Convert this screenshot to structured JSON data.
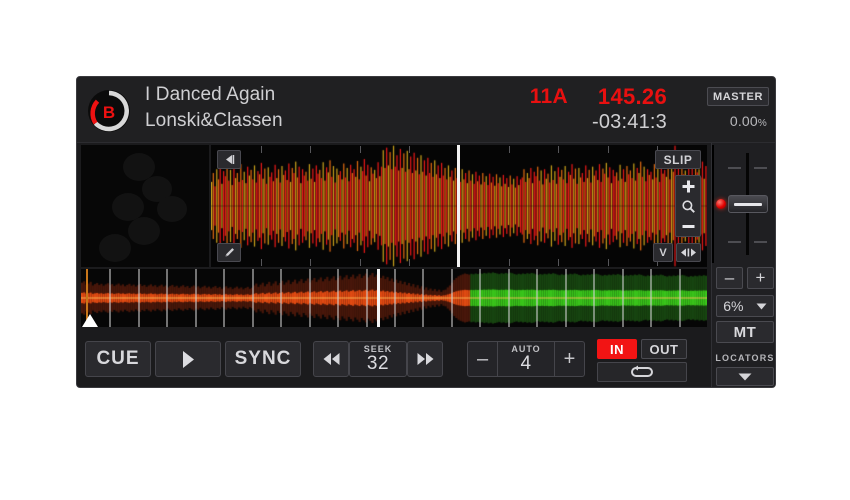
{
  "deck": {
    "badge_letter": "B",
    "badge_progress_color": "#ee1111",
    "badge_ring_color": "#d8d8d8"
  },
  "track": {
    "title": "I Danced Again",
    "artist": "Lonski&Classen",
    "key": "11A",
    "bpm": "145.26",
    "time_remaining": "-03:41:3"
  },
  "header": {
    "master_label": "MASTER",
    "pitch_percent": "0.00",
    "pitch_percent_symbol": "%"
  },
  "waveform": {
    "back_icon": "triangle-left-icon",
    "pencil_icon": "pencil-icon",
    "slip_label": "SLIP",
    "zoom_in_icon": "plus-icon",
    "zoom_icon": "magnifier-icon",
    "zoom_out_icon": "minus-icon",
    "view_label": "V",
    "pan_icon": "left-right-arrows-icon",
    "playhead_position_pct": 49.6
  },
  "overview": {
    "playhead_position_pct": 47.3,
    "start_marker_icon": "triangle-up-marker"
  },
  "transport": {
    "cue_label": "CUE",
    "play_icon": "play-triangle-icon",
    "sync_label": "SYNC",
    "rewind_icon": "rewind-icon",
    "forward_icon": "fast-forward-icon",
    "seek_caption": "SEEK",
    "seek_value": "32",
    "auto_caption": "AUTO",
    "auto_value": "4",
    "minus_label": "–",
    "plus_label": "+",
    "loop_in_label": "IN",
    "loop_out_label": "OUT",
    "loop_repeat_icon": "loop-repeat-icon",
    "loop_in_active_color": "#f21414"
  },
  "pitch_panel": {
    "minus_label": "–",
    "plus_label": "+",
    "range_value": "6%",
    "range_chevron_icon": "chevron-down-icon",
    "master_tempo_label": "MT",
    "locators_label": "LOCATORS",
    "locators_chevron_icon": "chevron-down-icon",
    "led_color": "#e00000"
  },
  "chart_data": {
    "type": "area",
    "title": "Main waveform amplitude (red/orange energy)",
    "main_wave": [
      0.38,
      0.52,
      0.31,
      0.58,
      0.42,
      0.61,
      0.35,
      0.55,
      0.47,
      0.63,
      0.4,
      0.57,
      0.33,
      0.6,
      0.44,
      0.52,
      0.38,
      0.66,
      0.41,
      0.54,
      0.36,
      0.62,
      0.48,
      0.57,
      0.42,
      0.64,
      0.37,
      0.55,
      0.5,
      0.68,
      0.43,
      0.59,
      0.35,
      0.61,
      0.46,
      0.53,
      0.39,
      0.65,
      0.44,
      0.58,
      0.37,
      0.63,
      0.49,
      0.56,
      0.41,
      0.67,
      0.38,
      0.6,
      0.52,
      0.7,
      0.45,
      0.62,
      0.36,
      0.58,
      0.48,
      0.54,
      0.4,
      0.66,
      0.43,
      0.59,
      0.38,
      0.64,
      0.51,
      0.57,
      0.44,
      0.69,
      0.4,
      0.61,
      0.53,
      0.72,
      0.46,
      0.63,
      0.37,
      0.59,
      0.49,
      0.55,
      0.42,
      0.67,
      0.45,
      0.6,
      0.39,
      0.65,
      0.52,
      0.58,
      0.46,
      0.71,
      0.42,
      0.62,
      0.55,
      0.74,
      0.48,
      0.65,
      0.39,
      0.61,
      0.51,
      0.57,
      0.44,
      0.69,
      0.47,
      0.62,
      0.88,
      0.6,
      0.92,
      0.64,
      0.85,
      0.58,
      0.95,
      0.62,
      0.8,
      0.56,
      0.9,
      0.6,
      0.83,
      0.54,
      0.87,
      0.58,
      0.78,
      0.52,
      0.84,
      0.56,
      0.76,
      0.5,
      0.8,
      0.54,
      0.72,
      0.48,
      0.76,
      0.52,
      0.68,
      0.46,
      0.72,
      0.5,
      0.64,
      0.44,
      0.68,
      0.48,
      0.6,
      0.42,
      0.64,
      0.46,
      0.56,
      0.4,
      0.6,
      0.44,
      0.54,
      0.38,
      0.58,
      0.42,
      0.52,
      0.36,
      0.56,
      0.4,
      0.5,
      0.35,
      0.54,
      0.39,
      0.48,
      0.34,
      0.52,
      0.38,
      0.47,
      0.33,
      0.51,
      0.37,
      0.46,
      0.32,
      0.5,
      0.36,
      0.45,
      0.31,
      0.49,
      0.35,
      0.44,
      0.3,
      0.48,
      0.34,
      0.43,
      0.29,
      0.47,
      0.33,
      0.42,
      0.45,
      0.58,
      0.38,
      0.52,
      0.44,
      0.6,
      0.36,
      0.54,
      0.47,
      0.62,
      0.4,
      0.56,
      0.34,
      0.58,
      0.43,
      0.51,
      0.37,
      0.64,
      0.41,
      0.55,
      0.35,
      0.61,
      0.46,
      0.57,
      0.42,
      0.63,
      0.36,
      0.54,
      0.49,
      0.66,
      0.43,
      0.59,
      0.35,
      0.6,
      0.45,
      0.52,
      0.38,
      0.64,
      0.44,
      0.57,
      0.37,
      0.62,
      0.48,
      0.56,
      0.41,
      0.66,
      0.38,
      0.59,
      0.51,
      0.68,
      0.45,
      0.61,
      0.36,
      0.57,
      0.47,
      0.53,
      0.4,
      0.65,
      0.43,
      0.58,
      0.38,
      0.63,
      0.5,
      0.56,
      0.44,
      0.67,
      0.4,
      0.6,
      0.52,
      0.7,
      0.46,
      0.62,
      0.39,
      0.58,
      0.49,
      0.54,
      0.42,
      0.66,
      0.45,
      0.59,
      0.38,
      0.64,
      0.51,
      0.57,
      0.46,
      0.69,
      0.42,
      0.61,
      0.54,
      0.95,
      0.48,
      0.64,
      0.39,
      0.6,
      0.5,
      0.56,
      0.44,
      0.68,
      0.47,
      0.62,
      0.41,
      0.66,
      0.53,
      0.58,
      0.45,
      0.7,
      0.43,
      0.63
    ],
    "overview_wave": [
      0.55,
      0.6,
      0.48,
      0.52,
      0.58,
      0.45,
      0.5,
      0.54,
      0.47,
      0.51,
      0.44,
      0.49,
      0.53,
      0.46,
      0.5,
      0.43,
      0.48,
      0.52,
      0.45,
      0.49,
      0.42,
      0.47,
      0.51,
      0.44,
      0.48,
      0.41,
      0.46,
      0.5,
      0.43,
      0.47,
      0.4,
      0.45,
      0.49,
      0.42,
      0.46,
      0.39,
      0.44,
      0.48,
      0.41,
      0.45,
      0.38,
      0.43,
      0.47,
      0.4,
      0.44,
      0.37,
      0.42,
      0.46,
      0.39,
      0.43,
      0.36,
      0.41,
      0.45,
      0.38,
      0.42,
      0.35,
      0.4,
      0.44,
      0.37,
      0.41,
      0.34,
      0.39,
      0.43,
      0.36,
      0.4,
      0.33,
      0.38,
      0.42,
      0.35,
      0.39,
      0.32,
      0.37,
      0.41,
      0.34,
      0.38,
      0.31,
      0.36,
      0.4,
      0.33,
      0.37,
      0.45,
      0.52,
      0.4,
      0.48,
      0.55,
      0.42,
      0.5,
      0.58,
      0.44,
      0.52,
      0.6,
      0.46,
      0.54,
      0.62,
      0.48,
      0.56,
      0.64,
      0.5,
      0.58,
      0.66,
      0.52,
      0.6,
      0.68,
      0.54,
      0.62,
      0.7,
      0.56,
      0.64,
      0.72,
      0.58,
      0.66,
      0.74,
      0.6,
      0.68,
      0.76,
      0.62,
      0.7,
      0.78,
      0.64,
      0.72,
      0.8,
      0.66,
      0.74,
      0.82,
      0.68,
      0.76,
      0.84,
      0.7,
      0.78,
      0.86,
      0.72,
      0.8,
      0.88,
      0.74,
      0.82,
      0.9,
      0.76,
      0.84,
      0.85,
      0.72,
      0.8,
      0.68,
      0.75,
      0.62,
      0.7,
      0.58,
      0.66,
      0.54,
      0.62,
      0.5,
      0.58,
      0.46,
      0.54,
      0.42,
      0.5,
      0.38,
      0.46,
      0.34,
      0.42,
      0.3,
      0.38,
      0.28,
      0.34,
      0.26,
      0.32,
      0.24,
      0.3,
      0.22,
      0.28,
      0.3,
      0.38,
      0.45,
      0.55,
      0.65,
      0.72,
      0.78,
      0.82,
      0.85,
      0.88,
      0.86,
      0.84,
      0.87,
      0.85,
      0.88,
      0.86,
      0.89,
      0.87,
      0.9,
      0.88,
      0.91,
      0.89,
      0.92,
      0.9,
      0.88,
      0.86,
      0.89,
      0.87,
      0.9,
      0.88,
      0.91,
      0.89,
      0.86,
      0.84,
      0.87,
      0.85,
      0.88,
      0.86,
      0.89,
      0.87,
      0.9,
      0.88,
      0.85,
      0.83,
      0.86,
      0.84,
      0.87,
      0.85,
      0.88,
      0.86,
      0.89,
      0.87,
      0.84,
      0.82,
      0.85,
      0.83,
      0.86,
      0.84,
      0.87,
      0.85,
      0.88,
      0.86,
      0.83,
      0.81,
      0.84,
      0.82,
      0.85,
      0.83,
      0.86,
      0.84,
      0.87,
      0.85,
      0.82,
      0.8,
      0.83,
      0.81,
      0.84,
      0.82,
      0.85,
      0.83,
      0.86,
      0.84,
      0.81,
      0.79,
      0.82,
      0.8,
      0.83,
      0.81,
      0.84,
      0.82,
      0.85,
      0.83,
      0.8,
      0.78,
      0.81,
      0.79,
      0.82,
      0.8,
      0.83,
      0.81,
      0.84,
      0.82,
      0.79,
      0.77,
      0.8,
      0.78,
      0.81,
      0.79,
      0.82,
      0.8,
      0.83,
      0.81,
      0.78,
      0.76,
      0.79,
      0.77,
      0.8,
      0.78,
      0.81,
      0.79,
      0.82,
      0.8
    ],
    "overview_green_start_pct": 62,
    "beat_marker_count": 21
  }
}
